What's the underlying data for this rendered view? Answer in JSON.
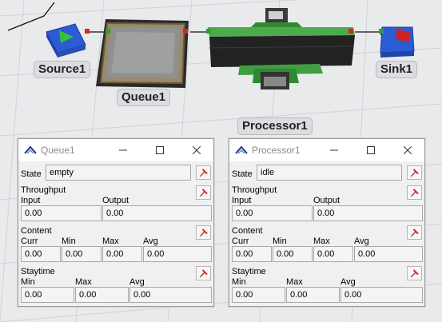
{
  "scene": {
    "objects": {
      "source_label": "Source1",
      "queue_label": "Queue1",
      "processor_label": "Processor1",
      "sink_label": "Sink1"
    }
  },
  "queue_window": {
    "title": "Queue1",
    "state_label": "State",
    "state_value": "empty",
    "throughput_label": "Throughput",
    "input_label": "Input",
    "output_label": "Output",
    "input_value": "0.00",
    "output_value": "0.00",
    "content_label": "Content",
    "curr_label": "Curr",
    "min_label": "Min",
    "max_label": "Max",
    "avg_label": "Avg",
    "content_curr": "0.00",
    "content_min": "0.00",
    "content_max": "0.00",
    "content_avg": "0.00",
    "staytime_label": "Staytime",
    "st_min_label": "Min",
    "st_max_label": "Max",
    "st_avg_label": "Avg",
    "staytime_min": "0.00",
    "staytime_max": "0.00",
    "staytime_avg": "0.00"
  },
  "processor_window": {
    "title": "Processor1",
    "state_label": "State",
    "state_value": "idle",
    "throughput_label": "Throughput",
    "input_label": "Input",
    "output_label": "Output",
    "input_value": "0.00",
    "output_value": "0.00",
    "content_label": "Content",
    "curr_label": "Curr",
    "min_label": "Min",
    "max_label": "Max",
    "avg_label": "Avg",
    "content_curr": "0.00",
    "content_min": "0.00",
    "content_max": "0.00",
    "content_avg": "0.00",
    "staytime_label": "Staytime",
    "st_min_label": "Min",
    "st_max_label": "Max",
    "st_avg_label": "Avg",
    "staytime_min": "0.00",
    "staytime_max": "0.00",
    "staytime_avg": "0.00"
  },
  "colors": {
    "background": "#e9eaec",
    "connector": "#111111",
    "port_green": "#22aa22",
    "port_red": "#dd2222",
    "source_blue": "#2c5bd6",
    "processor_green": "#3f9e3f"
  },
  "icons": {
    "window_logo": "flexsim-logo-icon",
    "minimize": "minimize-icon",
    "maximize": "maximize-icon",
    "close": "close-icon",
    "pin": "pin-icon"
  }
}
